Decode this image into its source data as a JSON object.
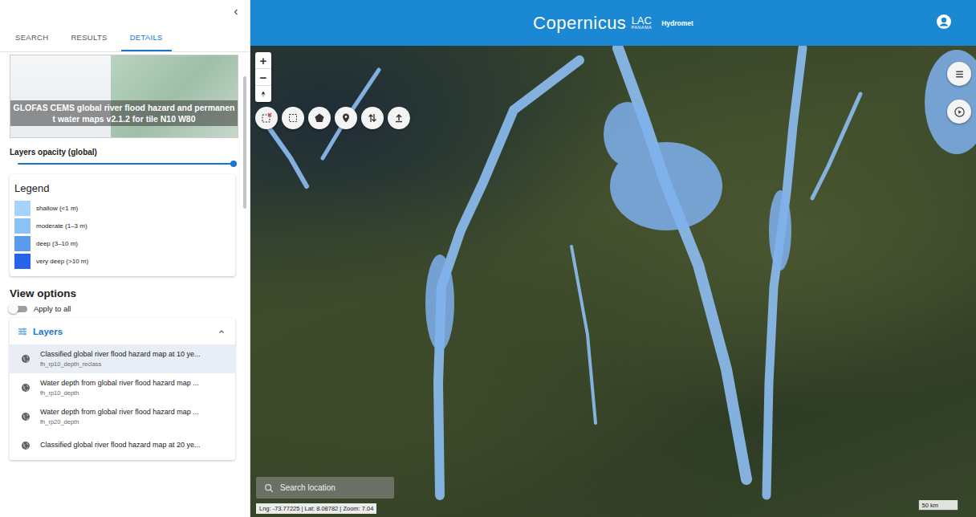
{
  "panel": {
    "tabs": [
      {
        "label": "SEARCH",
        "selected": false
      },
      {
        "label": "RESULTS",
        "selected": false
      },
      {
        "label": "DETAILS",
        "selected": true
      }
    ]
  },
  "dataset": {
    "title": "GLOFAS CEMS global river flood hazard and permanent water maps v2.1.2 for tile N10 W80"
  },
  "opacity": {
    "label": "Layers opacity (global)",
    "level": 1
  },
  "legend": {
    "title": "Legend",
    "items": [
      {
        "label": "shallow (<1 m)",
        "color": "#a6d3fb"
      },
      {
        "label": "moderate (1–3 m)",
        "color": "#8cc2f5"
      },
      {
        "label": "deep (3–10 m)",
        "color": "#5b9bee"
      },
      {
        "label": "very deep (>10 m)",
        "color": "#2563eb"
      }
    ]
  },
  "view_options": {
    "title": "View options",
    "apply_to_all": {
      "label": "Apply to all",
      "on": false
    }
  },
  "layers": {
    "title": "Layers",
    "expanded": true,
    "items": [
      {
        "title": "Classified global river flood hazard map at 10 ye...",
        "name": "fh_rp10_depth_reclass",
        "selected": true
      },
      {
        "title": "Water depth from global river flood hazard map ...",
        "name": "fh_rp10_depth",
        "selected": false
      },
      {
        "title": "Water depth from global river flood hazard map ...",
        "name": "fh_rp20_depth",
        "selected": false
      },
      {
        "title": "Classified global river flood hazard map at 20 ye...",
        "name": "",
        "selected": false
      }
    ]
  },
  "header": {
    "logo": "Copernicus",
    "region": "LAC",
    "country": "PANAMA",
    "product": "Hydromet"
  },
  "map": {
    "zoom_in": "+",
    "zoom_out": "−",
    "search": {
      "placeholder": "Search location"
    },
    "coordinates": "Lng: -73.77225 | Lat: 8.08782 | Zoom: 7.04",
    "scale": "50 km"
  }
}
